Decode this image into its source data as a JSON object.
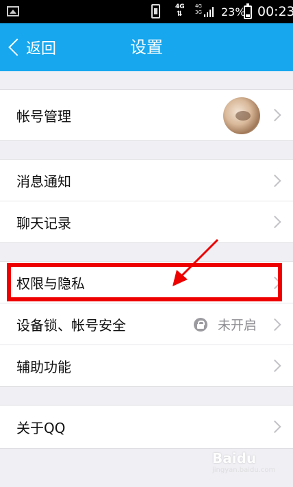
{
  "statusbar": {
    "net_4g": "4G",
    "net_4g_3g": "4G\n3G",
    "battery": "23%",
    "time": "00:23"
  },
  "titlebar": {
    "back_label": "返回",
    "title": "设置"
  },
  "settings": {
    "account": {
      "label": "帐号管理"
    },
    "notifications": {
      "label": "消息通知"
    },
    "chat_history": {
      "label": "聊天记录"
    },
    "privacy": {
      "label": "权限与隐私"
    },
    "device_lock": {
      "label": "设备锁、帐号安全",
      "status": "未开启"
    },
    "accessibility": {
      "label": "辅助功能"
    },
    "about": {
      "label": "关于QQ"
    }
  },
  "watermark": {
    "brand": "Baidu",
    "sub": "jingyan.baidu.com"
  },
  "colors": {
    "header": "#16a7ee",
    "background": "#efeff4",
    "annotation": "#ee0000"
  }
}
